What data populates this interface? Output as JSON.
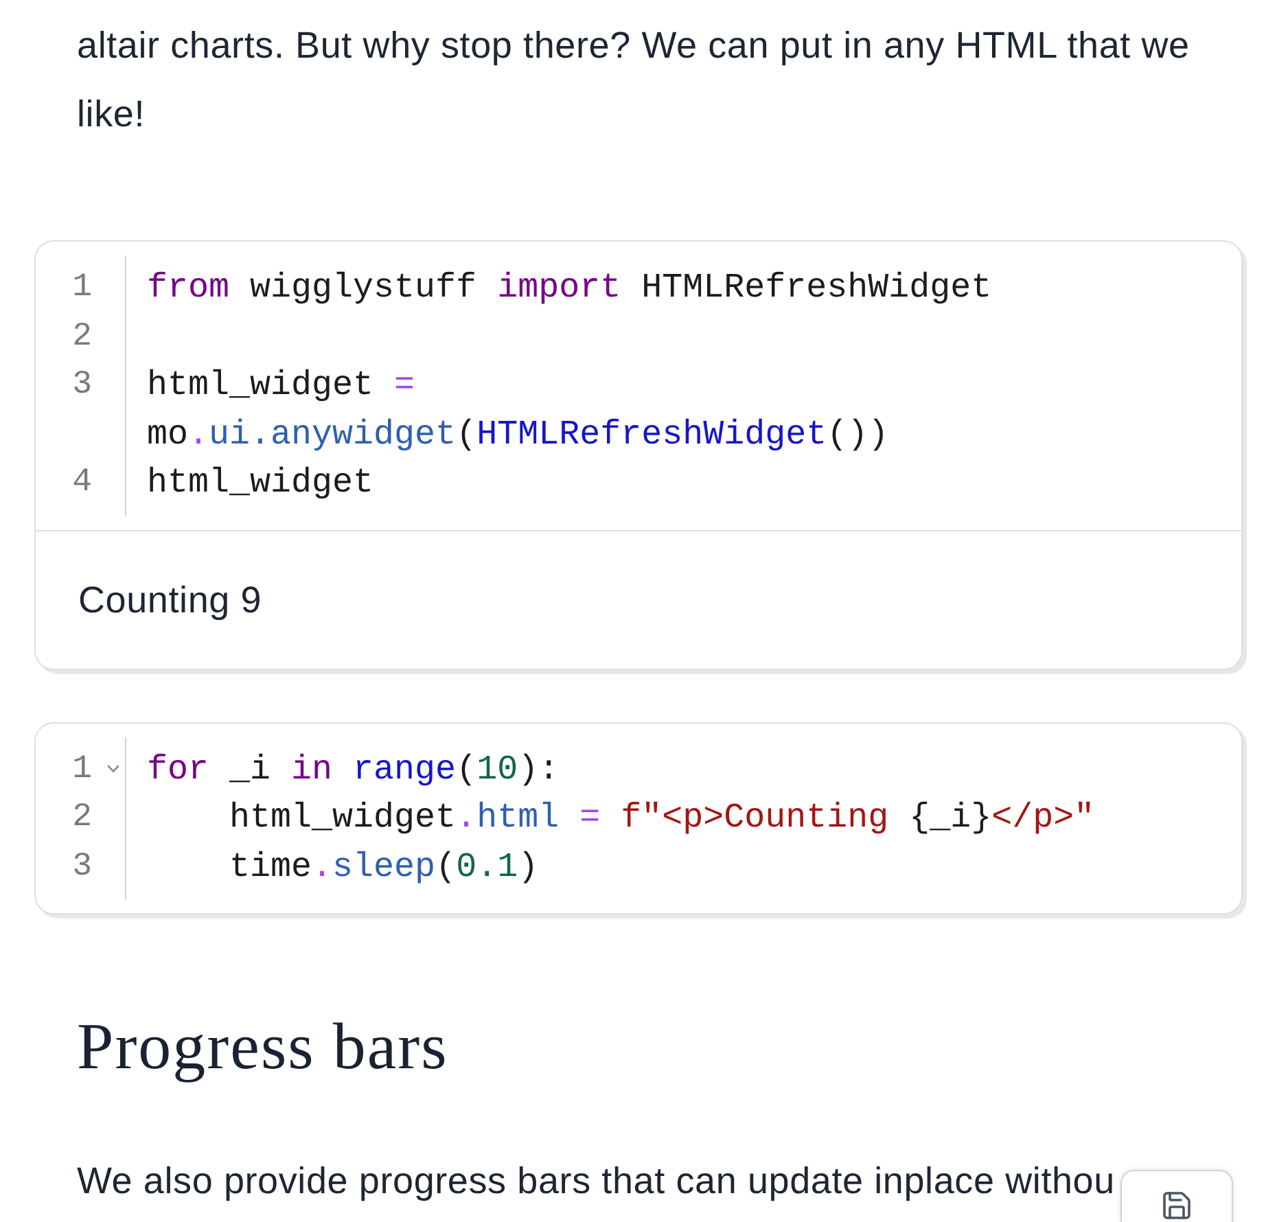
{
  "intro_paragraph": "altair charts. But why stop there? We can put in any HTML that we like!",
  "cells": [
    {
      "lines": [
        {
          "number": "1",
          "foldable": false,
          "tokens": [
            {
              "text": "from",
              "kind": "keyword"
            },
            {
              "text": " wigglystuff ",
              "kind": "plain"
            },
            {
              "text": "import",
              "kind": "keyword"
            },
            {
              "text": " HTMLRefreshWidget",
              "kind": "plain"
            }
          ]
        },
        {
          "number": "2",
          "foldable": false
        },
        {
          "number": "3",
          "foldable": false,
          "tokens": [
            {
              "text": "html_widget ",
              "kind": "plain"
            },
            {
              "text": "=",
              "kind": "operator"
            },
            {
              "text": " mo",
              "kind": "plain"
            },
            {
              "text": ".",
              "kind": "operator"
            },
            {
              "text": "ui.anywidget",
              "kind": "property"
            },
            {
              "text": "(",
              "kind": "plain"
            },
            {
              "text": "HTMLRefreshWidget",
              "kind": "callee"
            },
            {
              "text": "())",
              "kind": "plain"
            }
          ]
        },
        {
          "number": "4",
          "foldable": false,
          "tokens": [
            {
              "text": "html_widget",
              "kind": "plain"
            }
          ]
        }
      ],
      "output": "Counting 9"
    },
    {
      "lines": [
        {
          "number": "1",
          "foldable": true,
          "tokens": [
            {
              "text": "for",
              "kind": "keyword"
            },
            {
              "text": " _i ",
              "kind": "plain"
            },
            {
              "text": "in ",
              "kind": "keyword"
            },
            {
              "text": "range",
              "kind": "callee"
            },
            {
              "text": "(",
              "kind": "plain"
            },
            {
              "text": "10",
              "kind": "number"
            },
            {
              "text": "):",
              "kind": "plain"
            }
          ]
        },
        {
          "number": "2",
          "foldable": false,
          "tokens": [
            {
              "text": "    html_widget",
              "kind": "plain"
            },
            {
              "text": ".",
              "kind": "operator"
            },
            {
              "text": "html ",
              "kind": "property"
            },
            {
              "text": "= ",
              "kind": "operator"
            },
            {
              "text": "f\"<p>Counting ",
              "kind": "string"
            },
            {
              "text": "{_i}",
              "kind": "plain"
            },
            {
              "text": "</p>\"",
              "kind": "string"
            }
          ]
        },
        {
          "number": "3",
          "foldable": false,
          "tokens": [
            {
              "text": "    time",
              "kind": "plain"
            },
            {
              "text": ".",
              "kind": "operator"
            },
            {
              "text": "sleep",
              "kind": "property"
            },
            {
              "text": "(",
              "kind": "plain"
            },
            {
              "text": "0.1",
              "kind": "number"
            },
            {
              "text": ")",
              "kind": "plain"
            }
          ]
        }
      ]
    }
  ],
  "heading": "Progress bars",
  "paragraph": "We also provide progress bars that can update inplace withou"
}
